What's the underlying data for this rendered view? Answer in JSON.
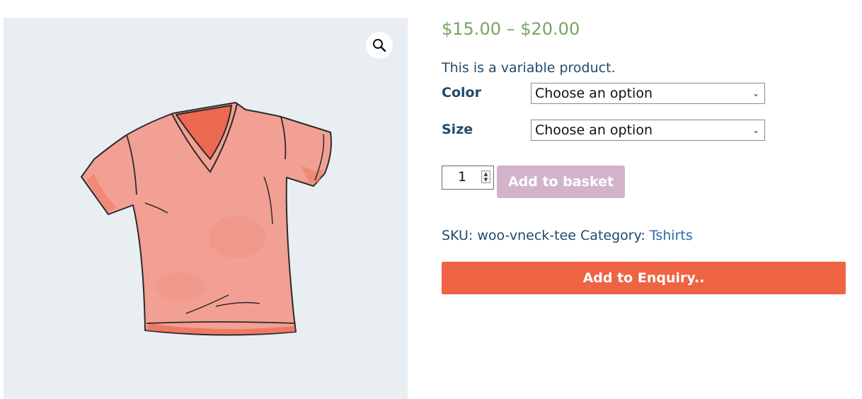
{
  "product": {
    "price_range": "$15.00 – $20.00",
    "description": "This is a variable product.",
    "image_subject": "v-neck-tshirt-illustration"
  },
  "variations": [
    {
      "label": "Color",
      "selected": "Choose an option"
    },
    {
      "label": "Size",
      "selected": "Choose an option"
    }
  ],
  "cart": {
    "quantity": "1",
    "add_to_basket_label": "Add to basket"
  },
  "meta": {
    "sku_label": "SKU:",
    "sku_value": "woo-vneck-tee",
    "category_label": "Category:",
    "category_value": "Tshirts"
  },
  "enquiry": {
    "label": "Add to Enquiry.."
  },
  "icons": {
    "zoom": "magnifier-icon",
    "select_arrow": "chevron-down-icon",
    "spinner": "up-down-arrows-icon"
  },
  "colors": {
    "price": "#77a464",
    "text": "#1f4b6e",
    "link": "#2d6aa7",
    "basket_button": "#d3b3cc",
    "enquiry_button": "#ee6443",
    "gallery_bg": "#e9eef2",
    "shirt": "#f2998a"
  }
}
